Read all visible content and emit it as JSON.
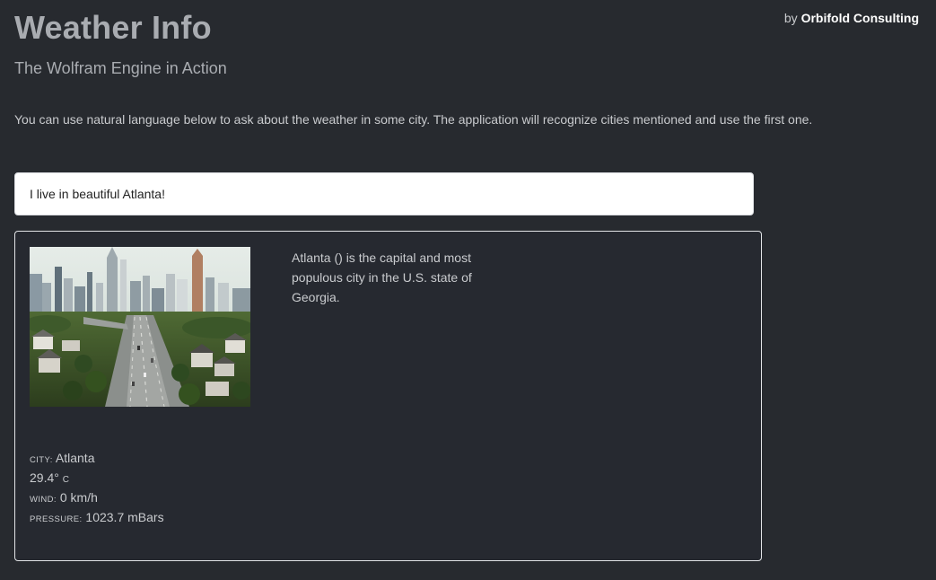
{
  "header": {
    "title": "Weather Info",
    "subtitle": "The Wolfram Engine in Action",
    "byline_prefix": "by",
    "byline_company": "Orbifold Consulting"
  },
  "intro": {
    "text": "You can use natural language below to ask about the weather in some city. The application will recognize cities mentioned and use the first one."
  },
  "query": {
    "value": "I live in beautiful Atlanta!"
  },
  "result": {
    "description": "Atlanta () is the capital and most populous city in the U.S. state of Georgia.",
    "stats": {
      "city_label": "city:",
      "city_value": "Atlanta",
      "temperature_value": "29.4°",
      "temperature_unit": "c",
      "wind_label": "wind:",
      "wind_value": "0 km/h",
      "pressure_label": "pressure:",
      "pressure_value": "1023.7 mBars"
    }
  },
  "colors": {
    "background": "#272a2f",
    "title": "#a9acb1",
    "text": "#c9cbce",
    "accent": "#ffffff"
  }
}
